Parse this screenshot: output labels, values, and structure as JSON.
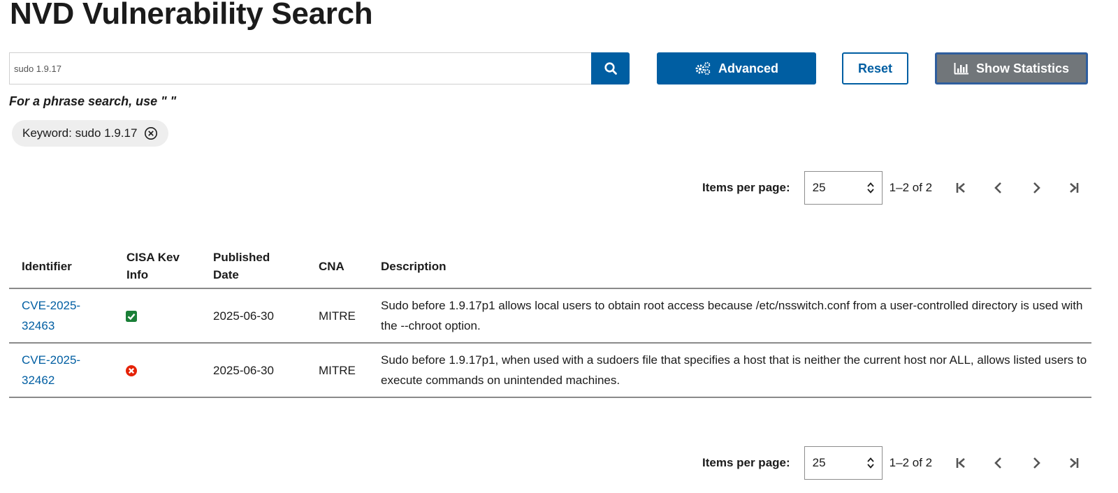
{
  "page": {
    "title": "NVD Vulnerability Search"
  },
  "search": {
    "value": "sudo 1.9.17",
    "hint": "For a phrase search, use \" \""
  },
  "buttons": {
    "advanced": "Advanced",
    "reset": "Reset",
    "statistics": "Show Statistics"
  },
  "filters": {
    "keyword_chip": "Keyword: sudo 1.9.17"
  },
  "pagination": {
    "label": "Items per page:",
    "per_page": "25",
    "range": "1–2 of 2"
  },
  "table": {
    "headers": {
      "identifier": "Identifier",
      "kev": "CISA Kev Info",
      "published": "Published Date",
      "cna": "CNA",
      "description": "Description"
    },
    "rows": [
      {
        "id": "CVE-2025-32463",
        "kev_icon": "check-square-icon",
        "published": "2025-06-30",
        "cna": "MITRE",
        "description": "Sudo before 1.9.17p1 allows local users to obtain root access because /etc/nsswitch.conf from a user-controlled directory is used with the --chroot option."
      },
      {
        "id": "CVE-2025-32462",
        "kev_icon": "x-circle-icon",
        "published": "2025-06-30",
        "cna": "MITRE",
        "description": "Sudo before 1.9.17p1, when used with a sudoers file that specifies a host that is neither the current host nor ALL, allows listed users to execute commands on unintended machines."
      }
    ]
  },
  "colors": {
    "primary": "#005ea2",
    "stats_button": "#71767a",
    "kev_yes": "#1a7f37",
    "kev_no": "#e52207",
    "chip_bg": "#eeeeee"
  },
  "icons": {
    "search": "search-icon",
    "advanced": "gears-icon",
    "stats": "bar-chart-icon",
    "chip_close": "close-circle-icon",
    "first": "first-page-icon",
    "prev": "chevron-left-icon",
    "next": "chevron-right-icon",
    "last": "last-page-icon",
    "select": "updown-arrows-icon"
  }
}
